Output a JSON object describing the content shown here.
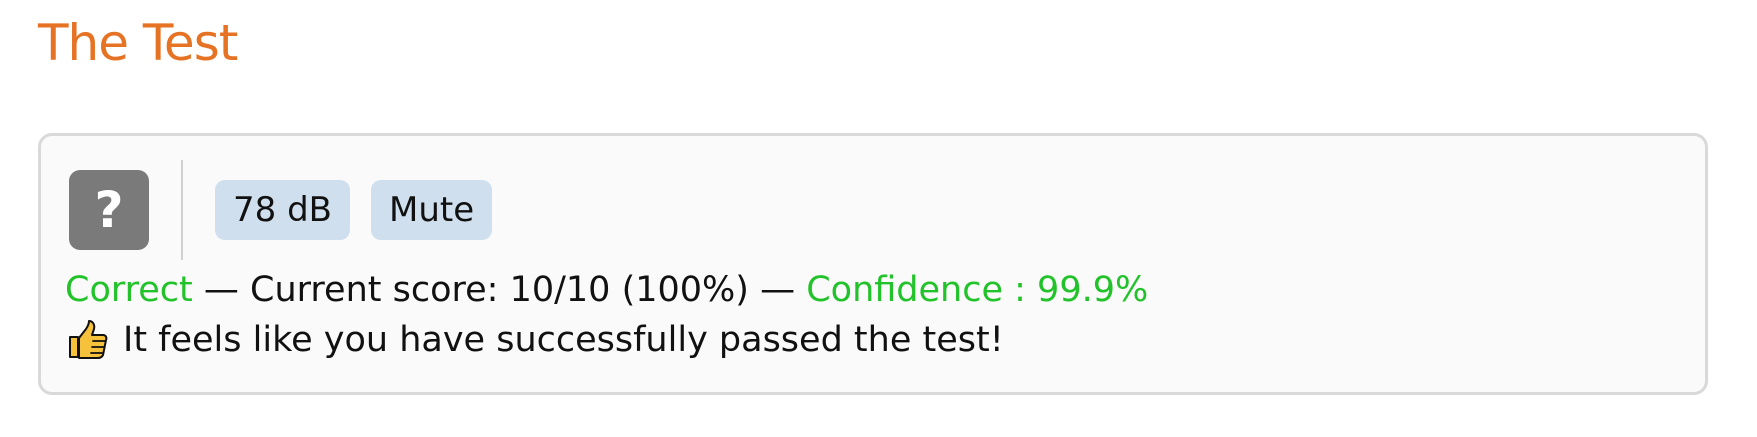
{
  "page": {
    "title": "The Test"
  },
  "controls": {
    "help_label": "?",
    "volume_label": "78 dB",
    "mute_label": "Mute"
  },
  "result": {
    "status": "Correct",
    "separator": "—",
    "score_text": "Current score: 10/10 (100%)",
    "confidence_text": "Confidence : 99.9%"
  },
  "message": {
    "icon": "thumbs-up-icon",
    "text": "It feels like you have successfully passed the test!"
  },
  "colors": {
    "title": "#e67224",
    "success": "#22c22a",
    "pill_background": "#cfdfed",
    "help_button": "#7a7a7a"
  }
}
